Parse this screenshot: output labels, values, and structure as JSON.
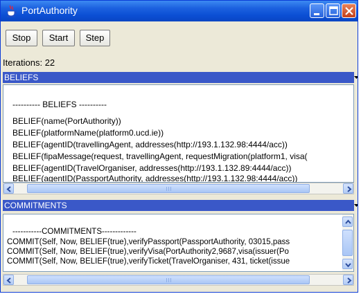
{
  "window": {
    "title": "PortAuthority"
  },
  "toolbar": {
    "stop_label": "Stop",
    "start_label": "Start",
    "step_label": "Step"
  },
  "status": {
    "iterations": "Iterations: 22"
  },
  "beliefs": {
    "header": "BELIEFS",
    "lines": [
      "---------- BELIEFS ----------",
      "BELIEF(name(PortAuthority))",
      "BELIEF(platformName(platform0.ucd.ie))",
      "BELIEF(agentID(travellingAgent, addresses(http://193.1.132.98:4444/acc))",
      "BELIEF(fipaMessage(request, travellingAgent, requestMigration(platform1, visa(",
      "BELIEF(agentID(TravelOrganiser, addresses(http://193.1.132.89:4444/acc))",
      "BELIEF(agentID(PassportAuthority, addresses(http://193.1.132.98:4444/acc))"
    ]
  },
  "commitments": {
    "header": "COMMITMENTS",
    "lines": [
      "-----------COMMITMENTS-------------",
      "COMMIT(Self, Now, BELIEF(true),verifyPassport(PassportAuthority, 03015,pass",
      "COMMIT(Self, Now, BELIEF(true),verifyVisa(PortAuthority2,9687,visa(issuer(Po",
      "COMMIT(Self, Now, BELIEF(true),verifyTicket(TravelOrganiser, 431, ticket(issue"
    ]
  },
  "colors": {
    "titlebar": "#0b4fd4",
    "panel_header": "#3a58c8",
    "window_bg": "#ece9d8"
  }
}
